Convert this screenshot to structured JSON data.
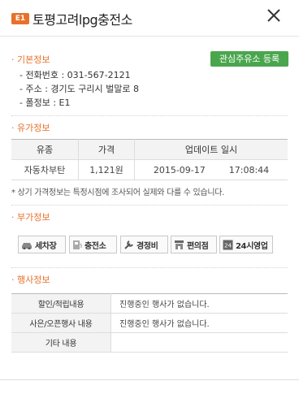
{
  "header": {
    "brand": "E1",
    "station_name": "토평고려lpg충전소"
  },
  "basic": {
    "title": "· 기본정보",
    "phone": "- 전화번호 : 031-567-2121",
    "address": "- 주소 : 경기도 구리시 벌말로 8",
    "pole": "- 폴정보 : E1",
    "fav_button": "관심주유소 등록"
  },
  "price": {
    "title": "· 유가정보",
    "headers": [
      "유종",
      "가격",
      "업데이트 일시"
    ],
    "rows": [
      {
        "fuel": "자동차부탄",
        "price": "1,121원",
        "date": "2015-09-17",
        "time": "17:08:44"
      }
    ],
    "note": "* 상기 가격정보는 특정시점에 조사되어 실제와 다를 수 있습니다."
  },
  "extra": {
    "title": "· 부가정보",
    "amenities": [
      {
        "label": "세차장",
        "icon": "car-wash-icon"
      },
      {
        "label": "충전소",
        "icon": "charging-station-icon"
      },
      {
        "label": "경정비",
        "icon": "repair-icon"
      },
      {
        "label": "편의점",
        "icon": "convenience-store-icon"
      },
      {
        "label": "24시영업",
        "icon": "24h-icon"
      }
    ]
  },
  "events": {
    "title": "· 행사정보",
    "rows": [
      {
        "label": "할인/적립내용",
        "value": "진행중인 행사가 없습니다."
      },
      {
        "label": "사은/오픈행사 내용",
        "value": "진행중인 행사가 없습니다."
      },
      {
        "label": "기타 내용",
        "value": ""
      }
    ]
  },
  "colors": {
    "accent": "#e8702a",
    "button_green": "#4aa64d"
  }
}
